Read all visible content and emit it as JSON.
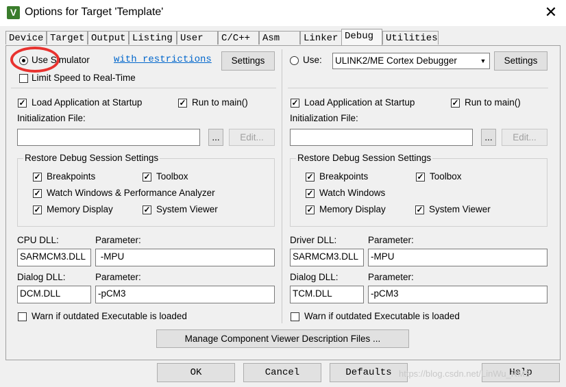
{
  "window": {
    "title": "Options for Target 'Template'",
    "close": "✕",
    "app_icon": "V"
  },
  "tabs": [
    "Device",
    "Target",
    "Output",
    "Listing",
    "User",
    "C/C++",
    "Asm",
    "Linker",
    "Debug",
    "Utilities"
  ],
  "active_tab": "Debug",
  "left": {
    "use_simulator_label": "Use Simulator",
    "use_simulator_selected": true,
    "with_restrictions": "with restrictions",
    "settings_label": "Settings",
    "limit_speed_label": "Limit Speed to Real-Time",
    "load_app_label": "Load Application at Startup",
    "run_to_main_label": "Run to main()",
    "init_file_label": "Initialization File:",
    "init_file_value": "",
    "browse_label": "...",
    "edit_label": "Edit...",
    "restore_group_label": "Restore Debug Session Settings",
    "breakpoints_label": "Breakpoints",
    "toolbox_label": "Toolbox",
    "watch_label": "Watch Windows & Performance Analyzer",
    "memory_label": "Memory Display",
    "sysviewer_label": "System Viewer",
    "dll_label": "CPU DLL:",
    "dll_param_label": "Parameter:",
    "dll_value": "SARMCM3.DLL",
    "dll_param_value": " -MPU",
    "dialog_dll_label": "Dialog DLL:",
    "dialog_param_label": "Parameter:",
    "dialog_dll_value": "DCM.DLL",
    "dialog_param_value": "-pCM3",
    "warn_label": "Warn if outdated Executable is loaded"
  },
  "right": {
    "use_label": "Use:",
    "use_selected": false,
    "debugger_value": "ULINK2/ME Cortex Debugger",
    "settings_label": "Settings",
    "load_app_label": "Load Application at Startup",
    "run_to_main_label": "Run to main()",
    "init_file_label": "Initialization File:",
    "init_file_value": "",
    "browse_label": "...",
    "edit_label": "Edit...",
    "restore_group_label": "Restore Debug Session Settings",
    "breakpoints_label": "Breakpoints",
    "toolbox_label": "Toolbox",
    "watch_label": "Watch Windows",
    "memory_label": "Memory Display",
    "sysviewer_label": "System Viewer",
    "dll_label": "Driver DLL:",
    "dll_param_label": "Parameter:",
    "dll_value": "SARMCM3.DLL",
    "dll_param_value": "-MPU",
    "dialog_dll_label": "Dialog DLL:",
    "dialog_param_label": "Parameter:",
    "dialog_dll_value": "TCM.DLL",
    "dialog_param_value": "-pCM3",
    "warn_label": "Warn if outdated Executable is loaded"
  },
  "manage_label": "Manage Component Viewer Description Files ...",
  "footer": {
    "ok": "OK",
    "cancel": "Cancel",
    "defaults": "Defaults",
    "help": "Help"
  },
  "check_glyph": "✓",
  "watermark": "https://blog.csdn.net/LinWu_RM3",
  "colors": {
    "highlight_circle": "#e8322f",
    "link": "#0066cc"
  }
}
